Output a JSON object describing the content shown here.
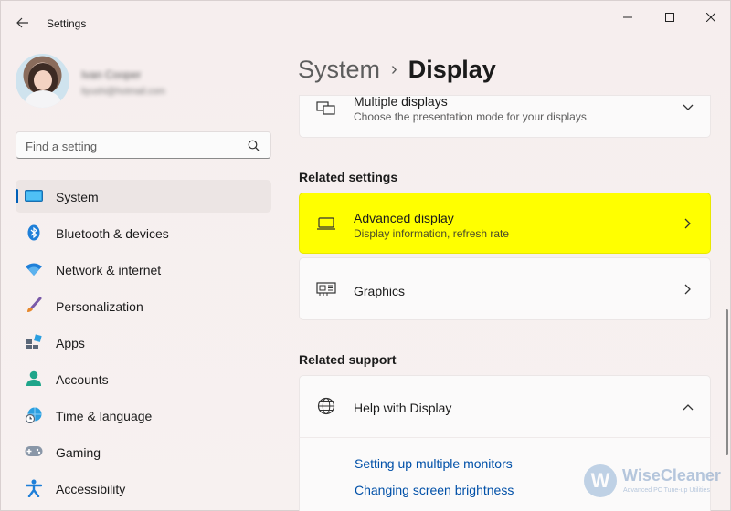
{
  "window": {
    "title": "Settings",
    "controls": [
      "minimize-icon",
      "maximize-icon",
      "close-icon"
    ]
  },
  "profile": {
    "name": "Ivan Cooper",
    "email": "liyushi@hotmail.com"
  },
  "search": {
    "placeholder": "Find a setting"
  },
  "sidebar": {
    "items": [
      {
        "label": "System",
        "icon": "system-icon",
        "active": true
      },
      {
        "label": "Bluetooth & devices",
        "icon": "bluetooth-icon"
      },
      {
        "label": "Network & internet",
        "icon": "wifi-icon"
      },
      {
        "label": "Personalization",
        "icon": "brush-icon"
      },
      {
        "label": "Apps",
        "icon": "apps-icon"
      },
      {
        "label": "Accounts",
        "icon": "account-icon"
      },
      {
        "label": "Time & language",
        "icon": "globe-clock-icon"
      },
      {
        "label": "Gaming",
        "icon": "gamepad-icon"
      },
      {
        "label": "Accessibility",
        "icon": "accessibility-icon"
      }
    ]
  },
  "breadcrumb": {
    "parent": "System",
    "separator": "›",
    "current": "Display"
  },
  "main": {
    "multiple_displays": {
      "title": "Multiple displays",
      "subtitle": "Choose the presentation mode for your displays"
    },
    "related_settings_title": "Related settings",
    "advanced_display": {
      "title": "Advanced display",
      "subtitle": "Display information, refresh rate"
    },
    "graphics": {
      "title": "Graphics"
    },
    "related_support_title": "Related support",
    "help": {
      "title": "Help with Display",
      "links": [
        "Setting up multiple monitors",
        "Changing screen brightness"
      ]
    }
  },
  "watermark": {
    "logo_letter": "W",
    "name": "WiseCleaner",
    "tagline": "Advanced PC Tune-up Utilities"
  },
  "colors": {
    "accent": "#005fb8",
    "highlight": "#ffff00",
    "link": "#0050a8"
  }
}
